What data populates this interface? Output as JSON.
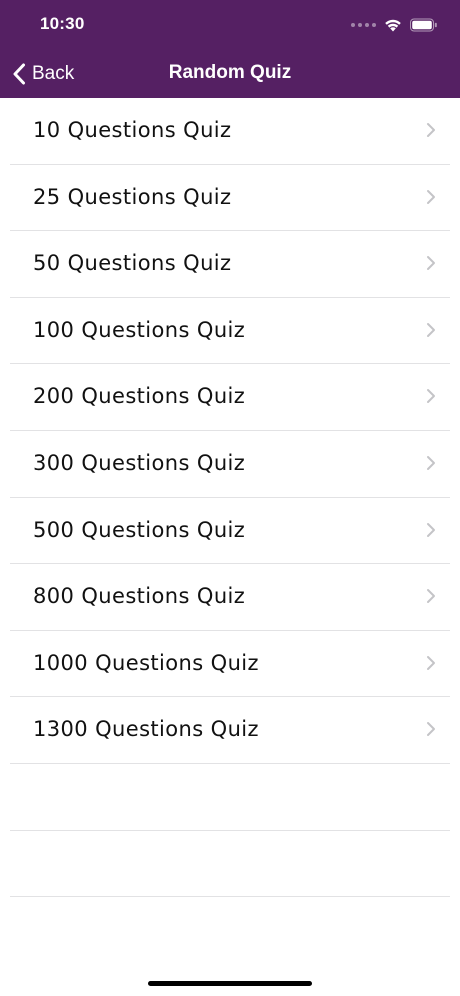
{
  "status_bar": {
    "time": "10:30"
  },
  "nav": {
    "back_label": "Back",
    "title": "Random Quiz"
  },
  "quiz_list": [
    {
      "label": "10 Questions Quiz"
    },
    {
      "label": "25 Questions Quiz"
    },
    {
      "label": "50 Questions Quiz"
    },
    {
      "label": "100 Questions Quiz"
    },
    {
      "label": "200 Questions Quiz"
    },
    {
      "label": "300 Questions Quiz"
    },
    {
      "label": "500 Questions Quiz"
    },
    {
      "label": "800 Questions Quiz"
    },
    {
      "label": "1000 Questions Quiz"
    },
    {
      "label": "1300 Questions Quiz"
    }
  ],
  "colors": {
    "header_bg": "#552063",
    "separator": "#e2e2e4",
    "chevron": "#c4c4c7"
  },
  "icons": {
    "back": "chevron-left-icon",
    "row_accessory": "chevron-right-icon",
    "wifi": "wifi-icon",
    "battery": "battery-icon"
  }
}
